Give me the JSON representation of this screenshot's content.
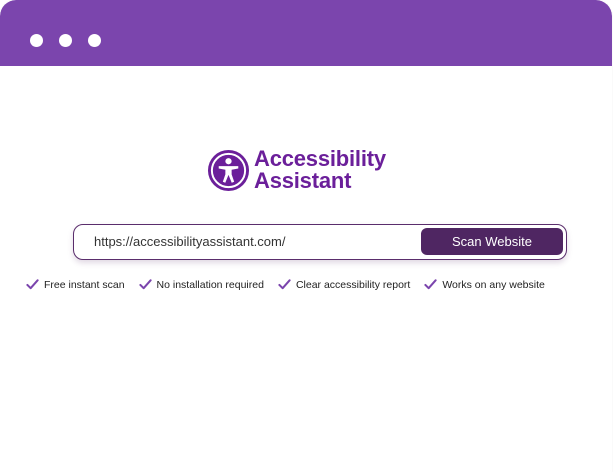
{
  "window": {
    "titlebar_color": "#7b45ad",
    "controls": [
      "window-dot",
      "window-dot",
      "window-dot"
    ]
  },
  "brand": {
    "line1": "Accessibility",
    "line2": "Assistant",
    "icon": "accessibility-person-icon",
    "color": "#6b1f9a"
  },
  "scan": {
    "url_value": "https://accessibilityassistant.com/",
    "button_label": "Scan Website",
    "button_color": "#4f2662"
  },
  "features": [
    {
      "label": "Free instant scan",
      "icon": "check-icon"
    },
    {
      "label": "No installation required",
      "icon": "check-icon"
    },
    {
      "label": "Clear accessibility report",
      "icon": "check-icon"
    },
    {
      "label": "Works on any website",
      "icon": "check-icon"
    }
  ],
  "colors": {
    "check": "#7b45ad"
  }
}
